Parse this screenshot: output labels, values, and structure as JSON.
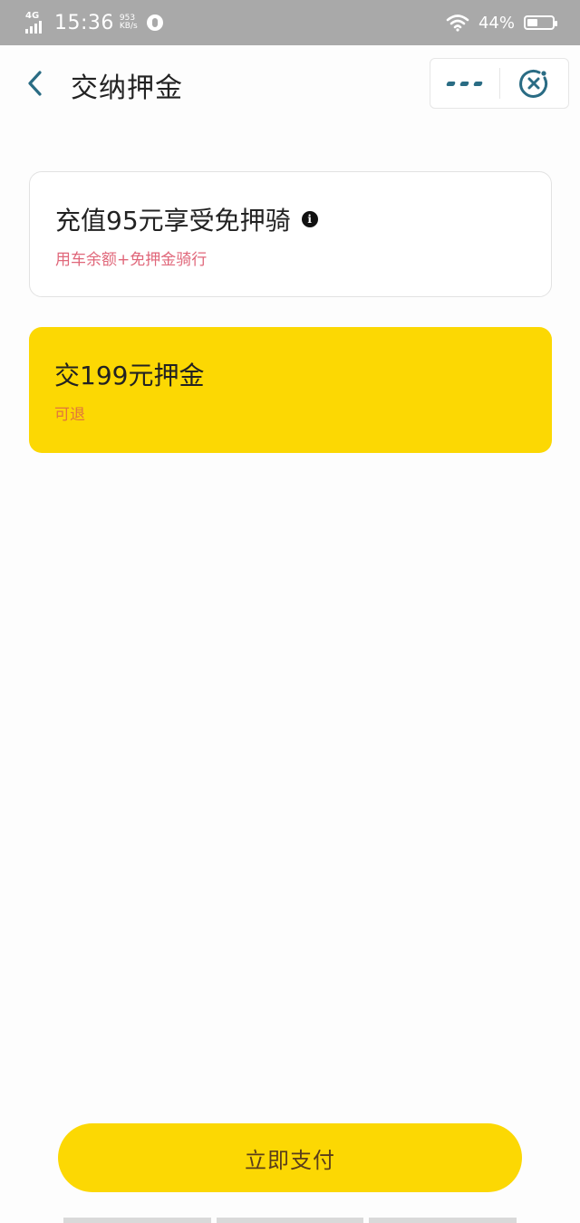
{
  "status_bar": {
    "network": "4G",
    "time": "15:36",
    "speed_value": "953",
    "speed_unit": "KB/s",
    "battery_percent": "44%",
    "battery_level": 0.44
  },
  "nav": {
    "title": "交纳押金"
  },
  "options": [
    {
      "title": "充值95元享受免押骑",
      "subtitle": "用车余额+免押金骑行",
      "selected": false
    },
    {
      "title": "交199元押金",
      "subtitle": "可退",
      "selected": true
    }
  ],
  "pay_button": {
    "label": "立即支付"
  },
  "colors": {
    "accent": "#fcd803",
    "back_arrow": "#2a6c84",
    "subtitle_pink": "#e0677a",
    "subtitle_orange": "#e0753d"
  }
}
